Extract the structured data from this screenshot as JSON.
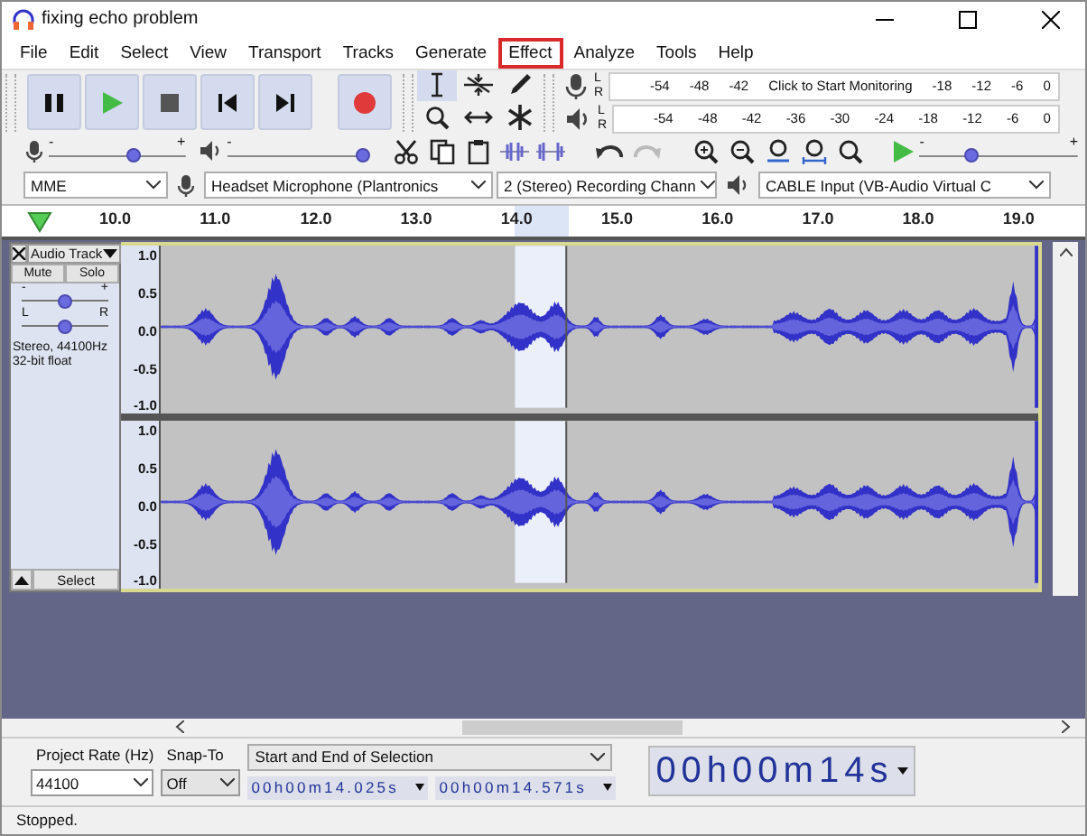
{
  "window": {
    "title": "fixing echo problem"
  },
  "menu": [
    {
      "label": "File",
      "highlighted": false
    },
    {
      "label": "Edit",
      "highlighted": false
    },
    {
      "label": "Select",
      "highlighted": false
    },
    {
      "label": "View",
      "highlighted": false
    },
    {
      "label": "Transport",
      "highlighted": false
    },
    {
      "label": "Tracks",
      "highlighted": false
    },
    {
      "label": "Generate",
      "highlighted": false
    },
    {
      "label": "Effect",
      "highlighted": true
    },
    {
      "label": "Analyze",
      "highlighted": false
    },
    {
      "label": "Tools",
      "highlighted": false
    },
    {
      "label": "Help",
      "highlighted": false
    }
  ],
  "recording_meter": {
    "left": "L",
    "right": "R",
    "scale_start": [
      "-54",
      "-48",
      "-42"
    ],
    "prompt": "Click to Start Monitoring",
    "scale_end": [
      "-18",
      "-12",
      "-6",
      "0"
    ]
  },
  "playback_meter": {
    "left": "L",
    "right": "R",
    "scale": [
      "-54",
      "-48",
      "-42",
      "-36",
      "-30",
      "-24",
      "-18",
      "-12",
      "-6",
      "0"
    ]
  },
  "recording_volume": {
    "min": "-",
    "max": "+",
    "level": 0.62
  },
  "playback_volume": {
    "min": "-",
    "level": 1.0
  },
  "play_at_speed": {
    "min": "-",
    "max": "+",
    "level": 0.33
  },
  "devices": {
    "host": "MME",
    "recording_device": "Headset Microphone (Plantronics",
    "channels": "2 (Stereo) Recording Chann",
    "playback_device": "CABLE Input (VB-Audio Virtual C"
  },
  "timeline": {
    "labels": [
      "10.0",
      "11.0",
      "12.0",
      "13.0",
      "14.0",
      "15.0",
      "16.0",
      "17.0",
      "18.0",
      "19.0"
    ]
  },
  "track": {
    "name": "Audio Track",
    "mute": "Mute",
    "solo": "Solo",
    "gain": {
      "min": "-",
      "max": "+",
      "level": 0.5
    },
    "pan": {
      "left": "L",
      "right": "R",
      "level": 0.5
    },
    "info": [
      "Stereo, 44100Hz",
      "32-bit float"
    ],
    "select": "Select",
    "channels": [
      {
        "scale": [
          "1.0",
          "0.5",
          "0.0",
          "-0.5",
          "-1.0"
        ]
      },
      {
        "scale": [
          "1.0",
          "0.5",
          "0.0",
          "-0.5",
          "-1.0"
        ]
      }
    ]
  },
  "selection_toolbar": {
    "rate_label": "Project Rate (Hz)",
    "rate": "44100",
    "snap_label": "Snap-To",
    "snap": "Off",
    "mode": "Start and End of Selection",
    "start": "00h00m14.025s",
    "end": "00h00m14.571s",
    "audio_position": "00h00m14s"
  },
  "status_bar": "Stopped."
}
